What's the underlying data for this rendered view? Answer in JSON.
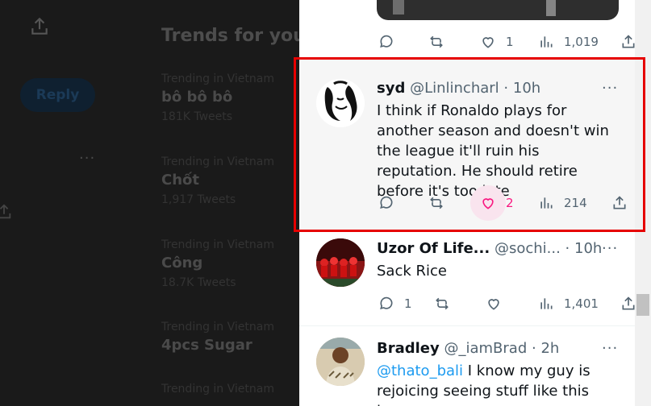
{
  "background": {
    "trends_title": "Trends for you",
    "reply_label": "Reply",
    "more_glyph": "···",
    "trends": [
      {
        "context": "Trending in Vietnam",
        "name": "bô bô bô",
        "count": "181K Tweets"
      },
      {
        "context": "Trending in Vietnam",
        "name": "Chốt",
        "count": "1,917 Tweets"
      },
      {
        "context": "Trending in Vietnam",
        "name": "Công",
        "count": "18.7K Tweets"
      },
      {
        "context": "Trending in Vietnam",
        "name": "4pcs Sugar",
        "count": ""
      },
      {
        "context": "Trending in Vietnam",
        "name": "",
        "count": ""
      }
    ]
  },
  "top_actions": {
    "reply_count": "",
    "retweet_count": "",
    "like_count": "1",
    "views": "1,019"
  },
  "tweets": [
    {
      "name": "syd",
      "handle": "@Linlincharl",
      "sep": "·",
      "time": "10h",
      "text": "I think if Ronaldo plays for another season and doesn't win the league it'll ruin his reputation. He should retire before it's too late",
      "reply_count": "",
      "retweet_count": "",
      "like_count": "2",
      "views": "214",
      "liked": true
    },
    {
      "name": "Uzor Of Life...",
      "handle": "@sochi...",
      "sep": "·",
      "time": "10h",
      "text": "Sack Rice",
      "reply_count": "1",
      "retweet_count": "",
      "like_count": "",
      "views": "1,401"
    },
    {
      "name": "Bradley",
      "handle": "@_iamBrad",
      "sep": "·",
      "time": "2h",
      "mention": "@thato_bali",
      "text": " I know my guy is rejoicing seeing stuff like this lmao"
    }
  ],
  "more_glyph": "···",
  "colors": {
    "accent": "#1d9bf0",
    "like": "#f91880",
    "highlight_border": "#e60000"
  },
  "icons": [
    "upload-icon",
    "reply-icon",
    "retweet-icon",
    "like-icon",
    "views-icon",
    "share-icon"
  ]
}
